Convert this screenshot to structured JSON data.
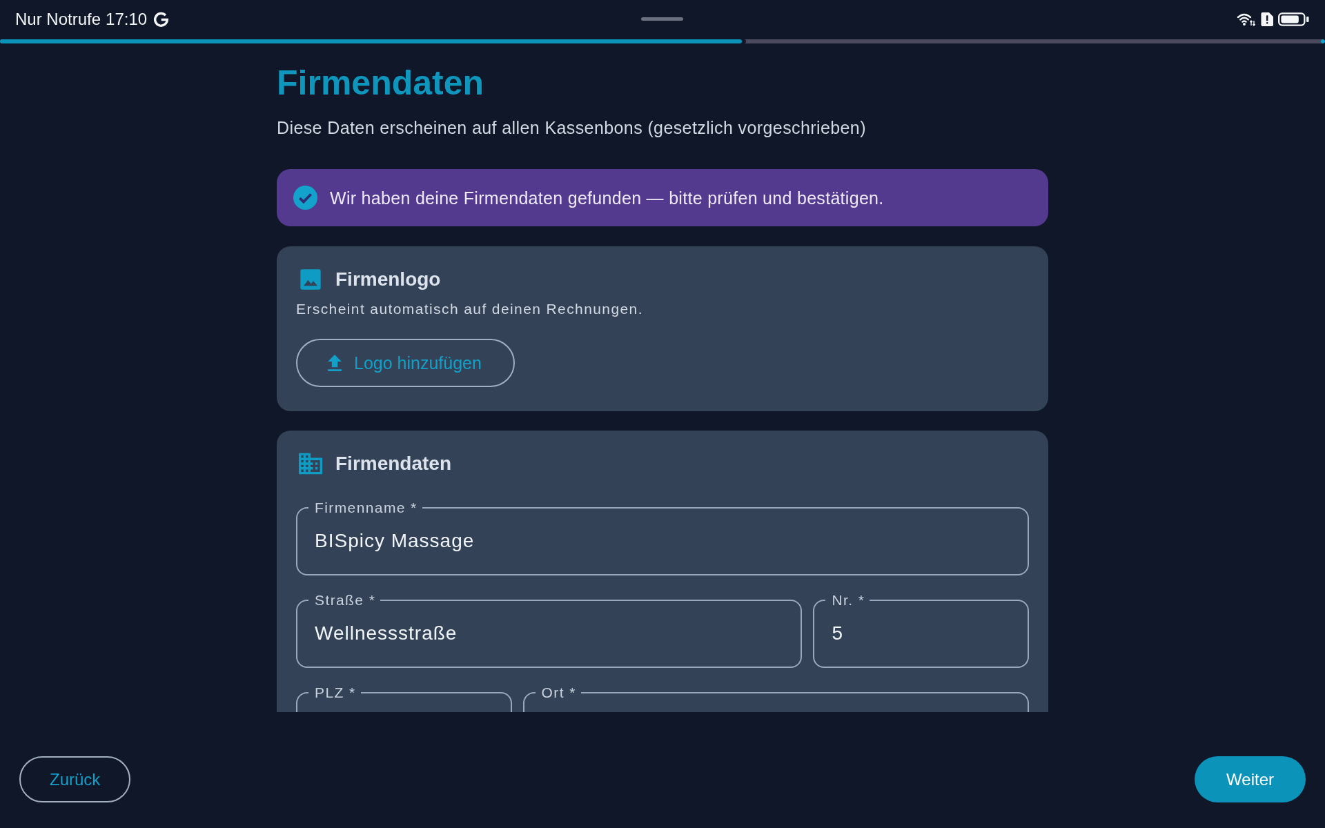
{
  "status_bar": {
    "network_text": "Nur Notrufe",
    "time": "17:10"
  },
  "progress": {
    "level": 0.56
  },
  "header": {
    "title": "Firmendaten",
    "subtitle": "Diese Daten erscheinen auf allen Kassenbons (gesetzlich vorgeschrieben)"
  },
  "banner": {
    "text": "Wir haben deine Firmendaten gefunden — bitte prüfen und bestätigen."
  },
  "cards": [
    {
      "kind": "logo",
      "title": "Firmenlogo",
      "description": "Erscheint automatisch auf deinen Rechnungen.",
      "button": {
        "label": "Logo hinzufügen"
      }
    },
    {
      "kind": "form",
      "title": "Firmendaten",
      "rows": [
        {
          "fields": [
            {
              "label": "Firmenname *",
              "value": "BISpicy Massage"
            }
          ]
        },
        {
          "fields": [
            {
              "label": "Straße *",
              "value": "Wellnessstraße"
            },
            {
              "label": "Nr. *",
              "value": "5"
            }
          ]
        },
        {
          "fields": [
            {
              "label": "PLZ *"
            },
            {
              "label": "Ort *"
            }
          ]
        }
      ]
    }
  ],
  "footer": {
    "back_button": {
      "label": "Zurück"
    },
    "next_button": {
      "label": "Weiter"
    }
  }
}
